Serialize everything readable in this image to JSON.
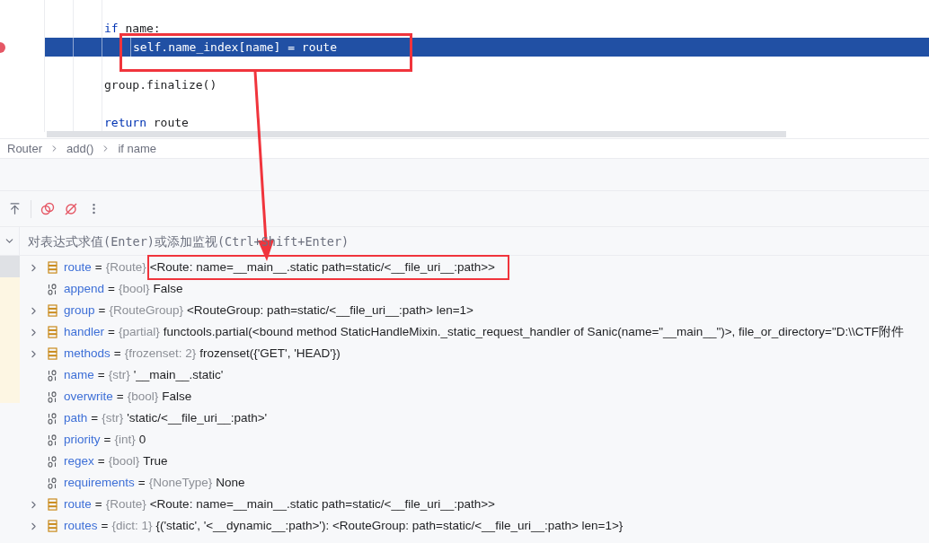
{
  "editor": {
    "lines": [
      {
        "breakpoint": false,
        "current": false
      },
      {
        "keyword": "if",
        "code": " name:",
        "breakpoint": false,
        "current": false,
        "children": [
          {
            "code": "self.name_index[name] = route",
            "breakpoint": true,
            "current": true
          }
        ]
      },
      {
        "breakpoint": false,
        "current": false
      },
      {
        "code": "group.finalize()",
        "breakpoint": false,
        "current": false
      },
      {
        "breakpoint": false,
        "current": false
      },
      {
        "keyword": "return",
        "code": " route",
        "breakpoint": false,
        "current": false
      }
    ]
  },
  "breadcrumb": [
    "Router",
    "add()",
    "if name"
  ],
  "evaluate": {
    "placeholder": "对表达式求值(Enter)或添加监视(Ctrl+Shift+Enter)"
  },
  "variables": [
    {
      "kind": "object",
      "name": "route",
      "sep": "=",
      "type": "{Route}",
      "value": "<Route: name=__main__.static path=static/<__file_uri__:path>>",
      "framed": true
    },
    {
      "kind": "primitive",
      "name": "append",
      "sep": "=",
      "type": "{bool}",
      "value": "False",
      "framed": false
    },
    {
      "kind": "object",
      "name": "group",
      "sep": "=",
      "type": "{RouteGroup}",
      "value": "<RouteGroup: path=static/<__file_uri__:path> len=1>",
      "framed": false
    },
    {
      "kind": "object",
      "name": "handler",
      "sep": "=",
      "type": "{partial}",
      "value": "functools.partial(<bound method StaticHandleMixin._static_request_handler of Sanic(name=\"__main__\")>, file_or_directory=\"D:\\\\CTF附件",
      "framed": false
    },
    {
      "kind": "object",
      "name": "methods",
      "sep": "=",
      "type": "{frozenset: 2}",
      "value": "frozenset({'GET', 'HEAD'})",
      "framed": false
    },
    {
      "kind": "primitive",
      "name": "name",
      "sep": "=",
      "type": "{str}",
      "value": "'__main__.static'",
      "framed": false
    },
    {
      "kind": "primitive",
      "name": "overwrite",
      "sep": "=",
      "type": "{bool}",
      "value": "False",
      "framed": false
    },
    {
      "kind": "primitive",
      "name": "path",
      "sep": "=",
      "type": "{str}",
      "value": "'static/<__file_uri__:path>'",
      "framed": false
    },
    {
      "kind": "primitive",
      "name": "priority",
      "sep": "=",
      "type": "{int}",
      "value": "0",
      "framed": false
    },
    {
      "kind": "primitive",
      "name": "regex",
      "sep": "=",
      "type": "{bool}",
      "value": "True",
      "framed": false
    },
    {
      "kind": "primitive",
      "name": "requirements",
      "sep": "=",
      "type": "{NoneType}",
      "value": "None",
      "framed": false
    },
    {
      "kind": "object",
      "name": "route",
      "sep": "=",
      "type": "{Route}",
      "value": "<Route: name=__main__.static path=static/<__file_uri__:path>>",
      "framed": false
    },
    {
      "kind": "object",
      "name": "routes",
      "sep": "=",
      "type": "{dict: 1}",
      "value": "{('static', '<__dynamic__:path>'): <RouteGroup: path=static/<__file_uri__:path> len=1>}",
      "framed": false
    }
  ]
}
